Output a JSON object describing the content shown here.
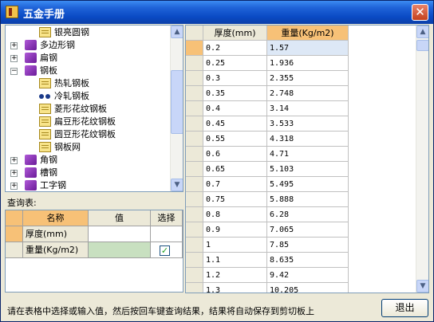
{
  "window": {
    "title": "五金手册",
    "close_glyph": "✕"
  },
  "tree": {
    "items": [
      {
        "label": "银亮圆钢",
        "icon": "yellow-book-icon",
        "level": 2
      },
      {
        "label": "多边形钢",
        "icon": "purple-book-icon",
        "level": 1,
        "expander": "+"
      },
      {
        "label": "扁钢",
        "icon": "purple-book-icon",
        "level": 1,
        "expander": "+"
      },
      {
        "label": "钢板",
        "icon": "purple-book-icon",
        "level": 1,
        "expander": "−"
      },
      {
        "label": "热轧钢板",
        "icon": "yellow-book-icon",
        "level": 2
      },
      {
        "label": "冷轧钢板",
        "icon": "glasses-icon",
        "level": 2
      },
      {
        "label": "菱形花纹钢板",
        "icon": "yellow-book-icon",
        "level": 2
      },
      {
        "label": "扁豆形花纹钢板",
        "icon": "yellow-book-icon",
        "level": 2
      },
      {
        "label": "圆豆形花纹钢板",
        "icon": "yellow-book-icon",
        "level": 2
      },
      {
        "label": "钢板网",
        "icon": "yellow-book-icon",
        "level": 2
      },
      {
        "label": "角钢",
        "icon": "purple-book-icon",
        "level": 1,
        "expander": "+"
      },
      {
        "label": "槽钢",
        "icon": "purple-book-icon",
        "level": 1,
        "expander": "+"
      },
      {
        "label": "工字钢",
        "icon": "purple-book-icon",
        "level": 1,
        "expander": "+"
      }
    ]
  },
  "query": {
    "label": "查询表:",
    "headers": {
      "name": "名称",
      "value": "值",
      "select": "选择"
    },
    "rows": [
      {
        "name": "厚度(mm)",
        "value": "",
        "checked": false
      },
      {
        "name": "重量(Kg/m2)",
        "value": "",
        "checked": true
      }
    ],
    "check_glyph": "✓"
  },
  "results": {
    "headers": {
      "thickness": "厚度(mm)",
      "weight": "重量(Kg/m2)"
    },
    "rows": [
      {
        "thickness": "0.2",
        "weight": "1.57"
      },
      {
        "thickness": "0.25",
        "weight": "1.936"
      },
      {
        "thickness": "0.3",
        "weight": "2.355"
      },
      {
        "thickness": "0.35",
        "weight": "2.748"
      },
      {
        "thickness": "0.4",
        "weight": "3.14"
      },
      {
        "thickness": "0.45",
        "weight": "3.533"
      },
      {
        "thickness": "0.55",
        "weight": "4.318"
      },
      {
        "thickness": "0.6",
        "weight": "4.71"
      },
      {
        "thickness": "0.65",
        "weight": "5.103"
      },
      {
        "thickness": "0.7",
        "weight": "5.495"
      },
      {
        "thickness": "0.75",
        "weight": "5.888"
      },
      {
        "thickness": "0.8",
        "weight": "6.28"
      },
      {
        "thickness": "0.9",
        "weight": "7.065"
      },
      {
        "thickness": "1",
        "weight": "7.85"
      },
      {
        "thickness": "1.1",
        "weight": "8.635"
      },
      {
        "thickness": "1.2",
        "weight": "9.42"
      },
      {
        "thickness": "1.3",
        "weight": "10.205"
      }
    ]
  },
  "scroll": {
    "up_glyph": "▲",
    "down_glyph": "▼"
  },
  "status_text": "请在表格中选择或输入值，然后按回车键查询结果，结果将自动保存到剪切板上",
  "exit_label": "退出",
  "colors": {
    "title_bar": "#0a4ac4",
    "header_accent": "#f7c177",
    "value_cell": "#c8e0c0"
  }
}
